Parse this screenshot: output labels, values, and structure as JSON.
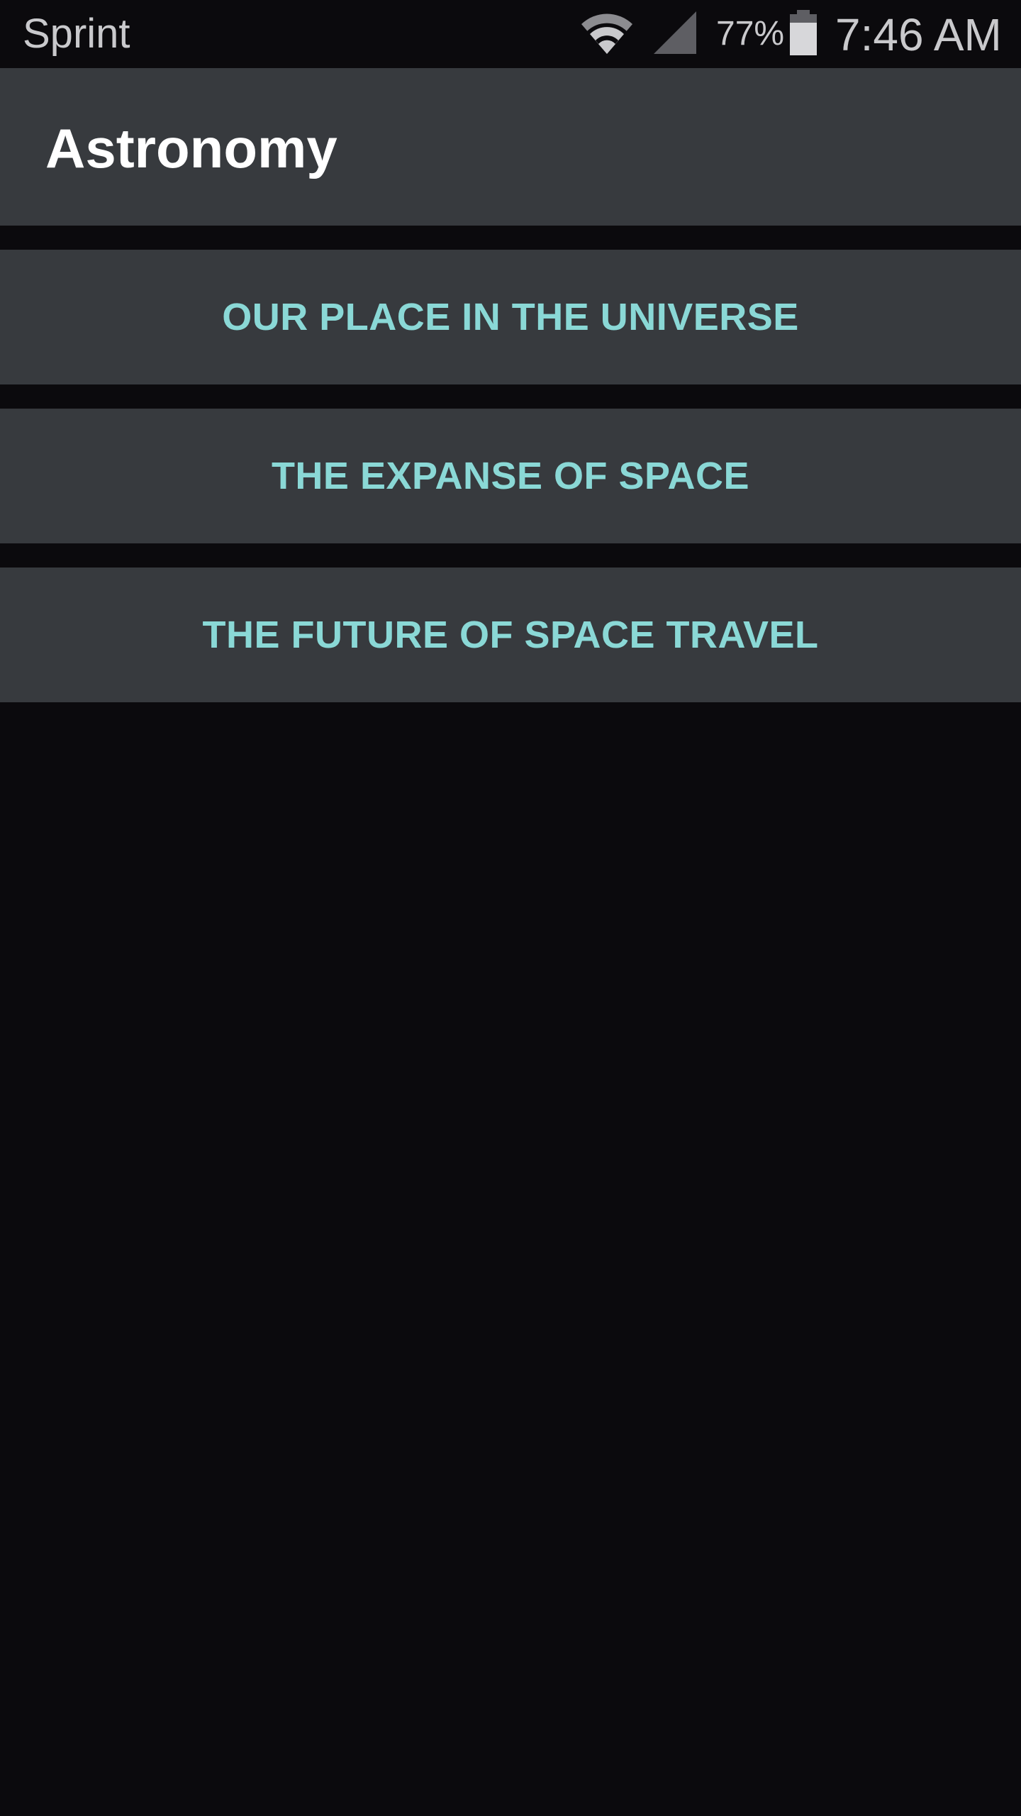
{
  "status_bar": {
    "carrier": "Sprint",
    "battery_percent": "77%",
    "time": "7:46 AM",
    "icons": [
      "wifi-icon",
      "cell-signal-icon",
      "battery-icon"
    ]
  },
  "app_bar": {
    "title": "Astronomy"
  },
  "topics": [
    {
      "label": "OUR PLACE IN THE UNIVERSE"
    },
    {
      "label": "THE EXPANSE OF SPACE"
    },
    {
      "label": "THE FUTURE OF SPACE TRAVEL"
    }
  ],
  "colors": {
    "background": "#0b0a0d",
    "surface": "#373a3e",
    "accent_text": "#8ad8d6",
    "title_text": "#ffffff",
    "status_text": "#c9c9cc"
  }
}
